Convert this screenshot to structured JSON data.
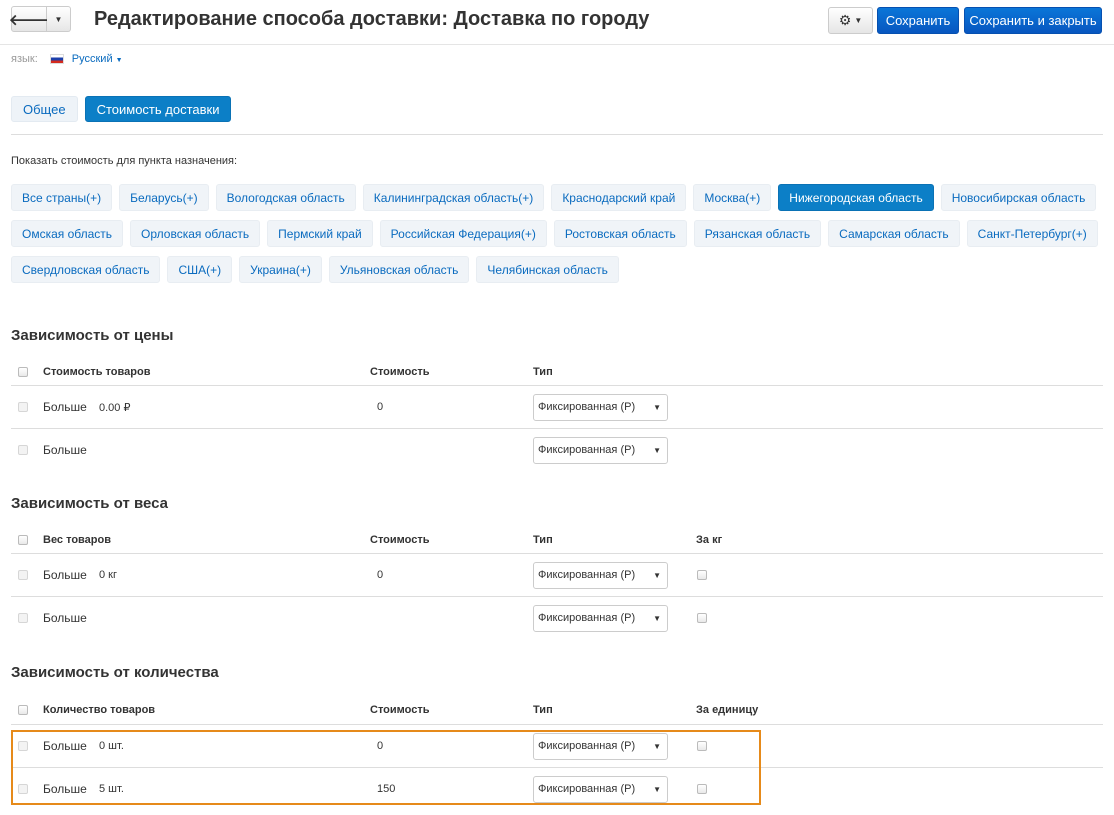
{
  "header": {
    "title": "Редактирование способа доставки: Доставка по городу",
    "save_label": "Сохранить",
    "save_close_label": "Сохранить и закрыть"
  },
  "language": {
    "label": "язык:",
    "value": "Русский"
  },
  "tabs": [
    {
      "label": "Общее",
      "active": false
    },
    {
      "label": "Стоимость доставки",
      "active": true
    }
  ],
  "destination_label": "Показать стоимость для пункта назначения:",
  "destinations": [
    {
      "label": "Все страны(+)",
      "active": false
    },
    {
      "label": "Беларусь(+)",
      "active": false
    },
    {
      "label": "Вологодская область",
      "active": false
    },
    {
      "label": "Калининградская область(+)",
      "active": false
    },
    {
      "label": "Краснодарский край",
      "active": false
    },
    {
      "label": "Москва(+)",
      "active": false
    },
    {
      "label": "Нижегородская область",
      "active": true
    },
    {
      "label": "Новосибирская область",
      "active": false
    },
    {
      "label": "Омская область",
      "active": false
    },
    {
      "label": "Орловская область",
      "active": false
    },
    {
      "label": "Пермский край",
      "active": false
    },
    {
      "label": "Российская Федерация(+)",
      "active": false
    },
    {
      "label": "Ростовская область",
      "active": false
    },
    {
      "label": "Рязанская область",
      "active": false
    },
    {
      "label": "Самарская область",
      "active": false
    },
    {
      "label": "Санкт-Петербург(+)",
      "active": false
    },
    {
      "label": "Свердловская область",
      "active": false
    },
    {
      "label": "США(+)",
      "active": false
    },
    {
      "label": "Украина(+)",
      "active": false
    },
    {
      "label": "Ульяновская область",
      "active": false
    },
    {
      "label": "Челябинская область",
      "active": false
    }
  ],
  "price_section": {
    "title": "Зависимость от цены",
    "headers": {
      "col1": "Стоимость товаров",
      "cost": "Стоимость",
      "type": "Тип"
    },
    "rows": [
      {
        "label": "Больше",
        "value": "0.00 ₽",
        "cost": "0",
        "type": "Фиксированная (Р)"
      },
      {
        "label": "Больше",
        "value": "",
        "cost": "",
        "type": "Фиксированная (Р)"
      }
    ]
  },
  "weight_section": {
    "title": "Зависимость от веса",
    "headers": {
      "col1": "Вес товаров",
      "cost": "Стоимость",
      "type": "Тип",
      "per": "За кг"
    },
    "rows": [
      {
        "label": "Больше",
        "value": "0 кг",
        "cost": "0",
        "type": "Фиксированная (Р)"
      },
      {
        "label": "Больше",
        "value": "",
        "cost": "",
        "type": "Фиксированная (Р)"
      }
    ]
  },
  "quantity_section": {
    "title": "Зависимость от количества",
    "headers": {
      "col1": "Количество товаров",
      "cost": "Стоимость",
      "type": "Тип",
      "per": "За единицу"
    },
    "rows": [
      {
        "label": "Больше",
        "value": "0 шт.",
        "cost": "0",
        "type": "Фиксированная (Р)"
      },
      {
        "label": "Больше",
        "value": "5 шт.",
        "cost": "150",
        "type": "Фиксированная (Р)"
      }
    ]
  },
  "colors": {
    "primary": "#0856c0",
    "accent": "#0c7fc7",
    "link": "#0a6bbf",
    "highlight": "#e68a1a"
  }
}
